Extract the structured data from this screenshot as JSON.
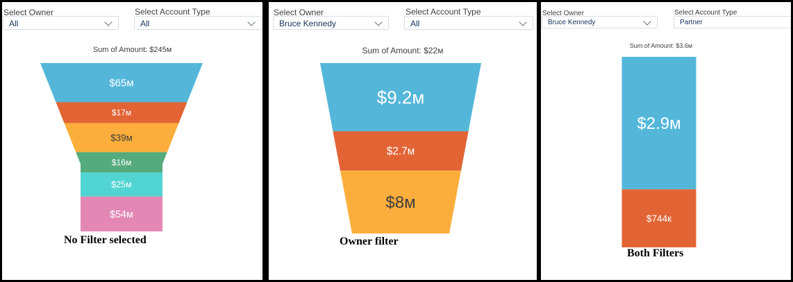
{
  "panels": [
    {
      "owner_label": "Select Owner",
      "owner_value": "All",
      "account_label": "Select Account Type",
      "account_value": "All",
      "sum_text": "Sum of Amount: $245м",
      "caption": "No Filter selected"
    },
    {
      "owner_label": "Select Owner",
      "owner_value": "Bruce Kennedy",
      "account_label": "Select Account Type",
      "account_value": "All",
      "sum_text": "Sum of Amount: $22м",
      "caption": "Owner filter"
    },
    {
      "owner_label": "Select Owner",
      "owner_value": "Bruce Kennedy",
      "account_label": "Select Account Type",
      "account_value": "Partner",
      "sum_text": "Sum of Amount: $3.6м",
      "caption": "Both Filters"
    }
  ],
  "chart_data": [
    {
      "type": "funnel",
      "title": "Sum of Amount: $245м",
      "total": 245,
      "unit": "millions USD",
      "stages": [
        {
          "label": "$65м",
          "value": 65,
          "color": "#54b7da"
        },
        {
          "label": "$17м",
          "value": 17,
          "color": "#e26435"
        },
        {
          "label": "$39м",
          "value": 39,
          "color": "#fcae3c"
        },
        {
          "label": "$16м",
          "value": 16,
          "color": "#55ab7d"
        },
        {
          "label": "$25м",
          "value": 25,
          "color": "#52d5d2"
        },
        {
          "label": "$54м",
          "value": 54,
          "color": "#e388b4"
        }
      ]
    },
    {
      "type": "funnel",
      "title": "Sum of Amount: $22м",
      "total": 22,
      "unit": "millions USD",
      "stages": [
        {
          "label": "$9.2м",
          "value": 9.2,
          "color": "#54b7da"
        },
        {
          "label": "$2.7м",
          "value": 2.7,
          "color": "#e26435"
        },
        {
          "label": "$8м",
          "value": 8,
          "color": "#fcae3c"
        }
      ]
    },
    {
      "type": "funnel",
      "title": "Sum of Amount: $3.6м",
      "total": 3.6,
      "unit": "millions USD",
      "stages": [
        {
          "label": "$2.9м",
          "value": 2.9,
          "color": "#54b7da"
        },
        {
          "label": "$744к",
          "value": 0.744,
          "color": "#e26435"
        }
      ]
    }
  ]
}
